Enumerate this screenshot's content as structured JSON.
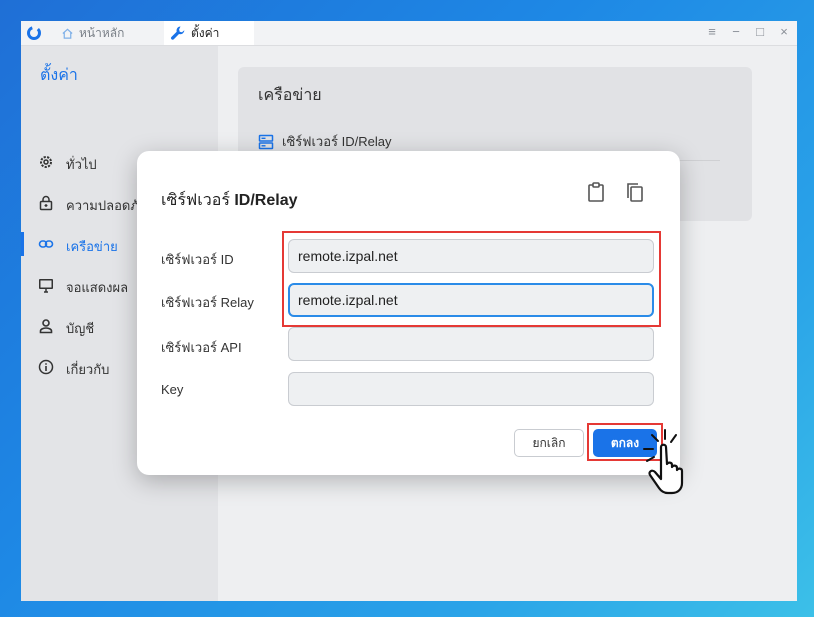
{
  "titlebar": {
    "tabs": [
      {
        "label": "หน้าหลัก",
        "icon": "home-icon"
      },
      {
        "label": "ตั้งค่า",
        "icon": "wrench-icon"
      }
    ],
    "controls": [
      "≡",
      "−",
      "□",
      "×"
    ]
  },
  "sidebar": {
    "title": "ตั้งค่า",
    "items": [
      {
        "label": "ทั่วไป",
        "icon": "gear-icon"
      },
      {
        "label": "ความปลอดภั",
        "icon": "lock-icon"
      },
      {
        "label": "เครือข่าย",
        "icon": "link-icon",
        "active": true
      },
      {
        "label": "จอแสดงผล",
        "icon": "monitor-icon"
      },
      {
        "label": "บัญชี",
        "icon": "person-icon"
      },
      {
        "label": "เกี่ยวกับ",
        "icon": "info-icon"
      }
    ]
  },
  "main": {
    "card_title": "เครือข่าย",
    "row_label": "เซิร์ฟเวอร์ ID/Relay",
    "row_icon": "server-icon"
  },
  "dialog": {
    "title_prefix": "เซิร์ฟเวอร์",
    "title_bold": "ID/Relay",
    "copy_icon": "clipboard-icon",
    "paste_icon": "copy-icon",
    "fields": [
      {
        "label": "เซิร์ฟเวอร์ ID",
        "value": "remote.izpal.net"
      },
      {
        "label": "เซิร์ฟเวอร์ Relay",
        "value": "remote.izpal.net"
      },
      {
        "label": "เซิร์ฟเวอร์ API",
        "value": ""
      },
      {
        "label": "Key",
        "value": ""
      }
    ],
    "cancel_label": "ยกเลิก",
    "ok_label": "ตกลง"
  },
  "colors": {
    "accent": "#1a73e8",
    "highlight": "#e53935"
  }
}
